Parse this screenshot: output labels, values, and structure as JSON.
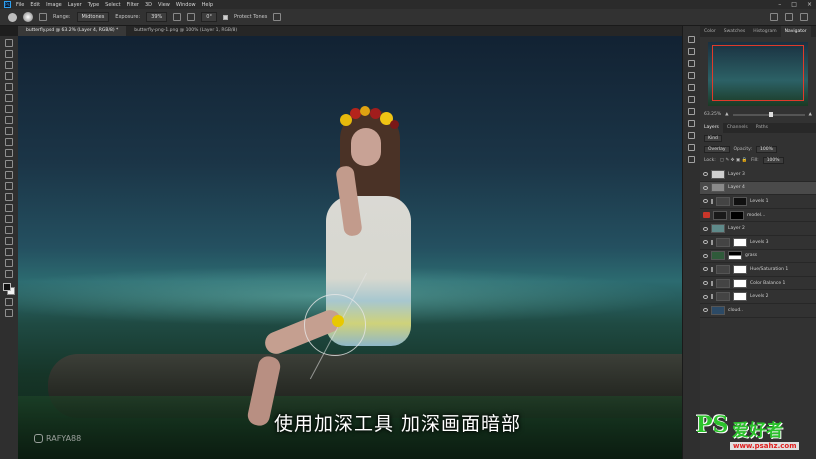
{
  "app": {
    "menu": [
      "File",
      "Edit",
      "Image",
      "Layer",
      "Type",
      "Select",
      "Filter",
      "3D",
      "View",
      "Window",
      "Help"
    ]
  },
  "options_bar": {
    "range_label": "Range:",
    "range_value": "Midtones",
    "exposure_label": "Exposure:",
    "exposure_value": "39%",
    "angle_value": "0°",
    "protect_tones_label": "Protect Tones",
    "protect_tones_checked": true
  },
  "document_tabs": [
    {
      "label": "butterfly.psd @ 63.2% (Layer 4, RGB/8) *",
      "active": true
    },
    {
      "label": "butterfly-png-1.png @ 100% (Layer 1, RGB/8)",
      "active": false
    }
  ],
  "canvas": {
    "subtitle": "使用加深工具 加深画面暗部",
    "watermark": "RAFYA88"
  },
  "site_logo": {
    "mark": "PS",
    "name": "爱好者",
    "url": "www.psahz.com"
  },
  "navigator": {
    "tabs": [
      "Color",
      "Swatches",
      "Histogram",
      "Navigator"
    ],
    "active_tab": "Navigator",
    "zoom": "63.25%"
  },
  "layers_panel": {
    "tabs": [
      "Layers",
      "Channels",
      "Paths"
    ],
    "active_tab": "Layers",
    "filter_label": "Kind",
    "blend_mode": "Overlay",
    "opacity_label": "Opacity:",
    "opacity_value": "100%",
    "lock_label": "Lock:",
    "fill_label": "Fill:",
    "fill_value": "100%",
    "layers": [
      {
        "name": "Layer 3",
        "active": false
      },
      {
        "name": "Layer 4",
        "active": true
      },
      {
        "name": "Levels 1",
        "active": false
      },
      {
        "name": "model...",
        "active": false
      },
      {
        "name": "Layer 2",
        "active": false
      },
      {
        "name": "Levels 3",
        "active": false
      },
      {
        "name": "grass",
        "active": false
      },
      {
        "name": "Hue/Saturation 1",
        "active": false
      },
      {
        "name": "Color Balance 1",
        "active": false
      },
      {
        "name": "Levels 2",
        "active": false
      },
      {
        "name": "cloud..",
        "active": false
      }
    ]
  },
  "colors": {
    "accent_red": "#c9362a",
    "brush_cursor": "#e8c800"
  }
}
